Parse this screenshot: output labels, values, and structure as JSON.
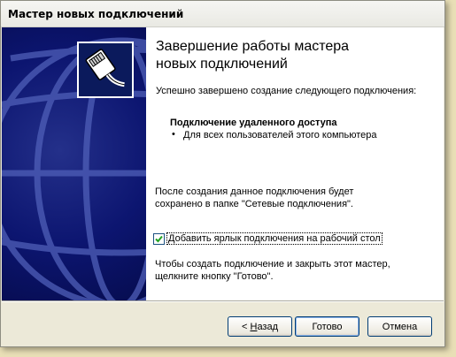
{
  "window": {
    "title": "Мастер новых подключений"
  },
  "wizard": {
    "heading_line1": "Завершение работы мастера",
    "heading_line2": "новых подключений",
    "success_text": "Успешно завершено создание следующего подключения:",
    "connection_name": "Подключение удаленного доступа",
    "bullet_symbol": "•",
    "connection_detail": "Для всех пользователей этого компьютера",
    "saved_line1": "После создания данное подключения будет",
    "saved_line2": "сохранено в папке \"Сетевые подключения\".",
    "shortcut_checkbox": {
      "label": "Добавить ярлык подключения на рабочий стол",
      "checked": true
    },
    "finish_line1": "Чтобы создать подключение и закрыть этот мастер,",
    "finish_line2": "щелкните кнопку \"Готово\"."
  },
  "buttons": {
    "back_arrow": "<",
    "back_accel": "Н",
    "back_rest": "азад",
    "finish": "Готово",
    "cancel": "Отмена"
  },
  "colors": {
    "sidebar": "#0c1570",
    "window_bg": "#ece9d8",
    "button_border": "#003c74"
  },
  "icons": {
    "sidebar_logo": "network-cable-icon",
    "sidebar_art": "globe-icon",
    "checkbox_mark": "checkmark-icon"
  }
}
